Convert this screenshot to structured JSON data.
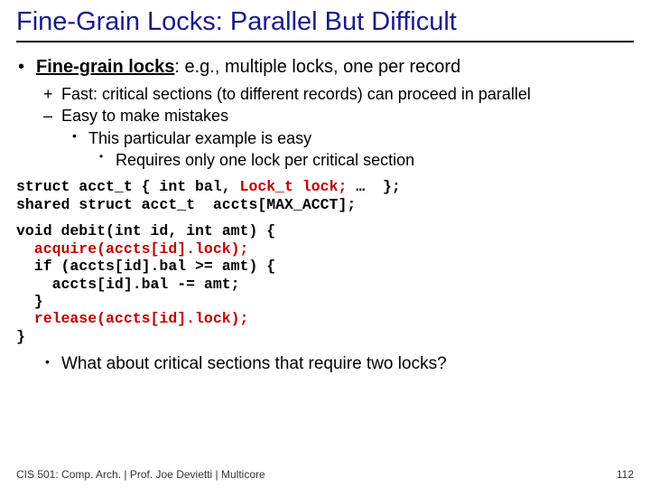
{
  "title": "Fine-Grain Locks: Parallel But Difficult",
  "bullet_main_bold": "Fine-grain locks",
  "bullet_main_rest": ": e.g., multiple locks, one per record",
  "sub_plus": "Fast: critical sections (to different records) can proceed in parallel",
  "sub_minus": "Easy to make mistakes",
  "sub2_a": "This particular example is easy",
  "sub3_a": "Requires only one lock per critical section",
  "code1_a": "struct acct_t { int bal, ",
  "code1_red": "Lock_t lock;",
  "code1_b": " …  };",
  "code1_line2": "shared struct acct_t  accts[MAX_ACCT];",
  "code2_l1": "void debit(int id, int amt) {",
  "code2_l2": "  acquire(accts[id].lock);",
  "code2_l3": "  if (accts[id].bal >= amt) {",
  "code2_l4": "    accts[id].bal -= amt;",
  "code2_l5": "  }",
  "code2_l6": "  release(accts[id].lock);",
  "code2_l7": "}",
  "closing": "What about critical sections that require two locks?",
  "footer_left": "CIS 501: Comp. Arch.  |  Prof. Joe Devietti  |  Multicore",
  "footer_right": "112"
}
